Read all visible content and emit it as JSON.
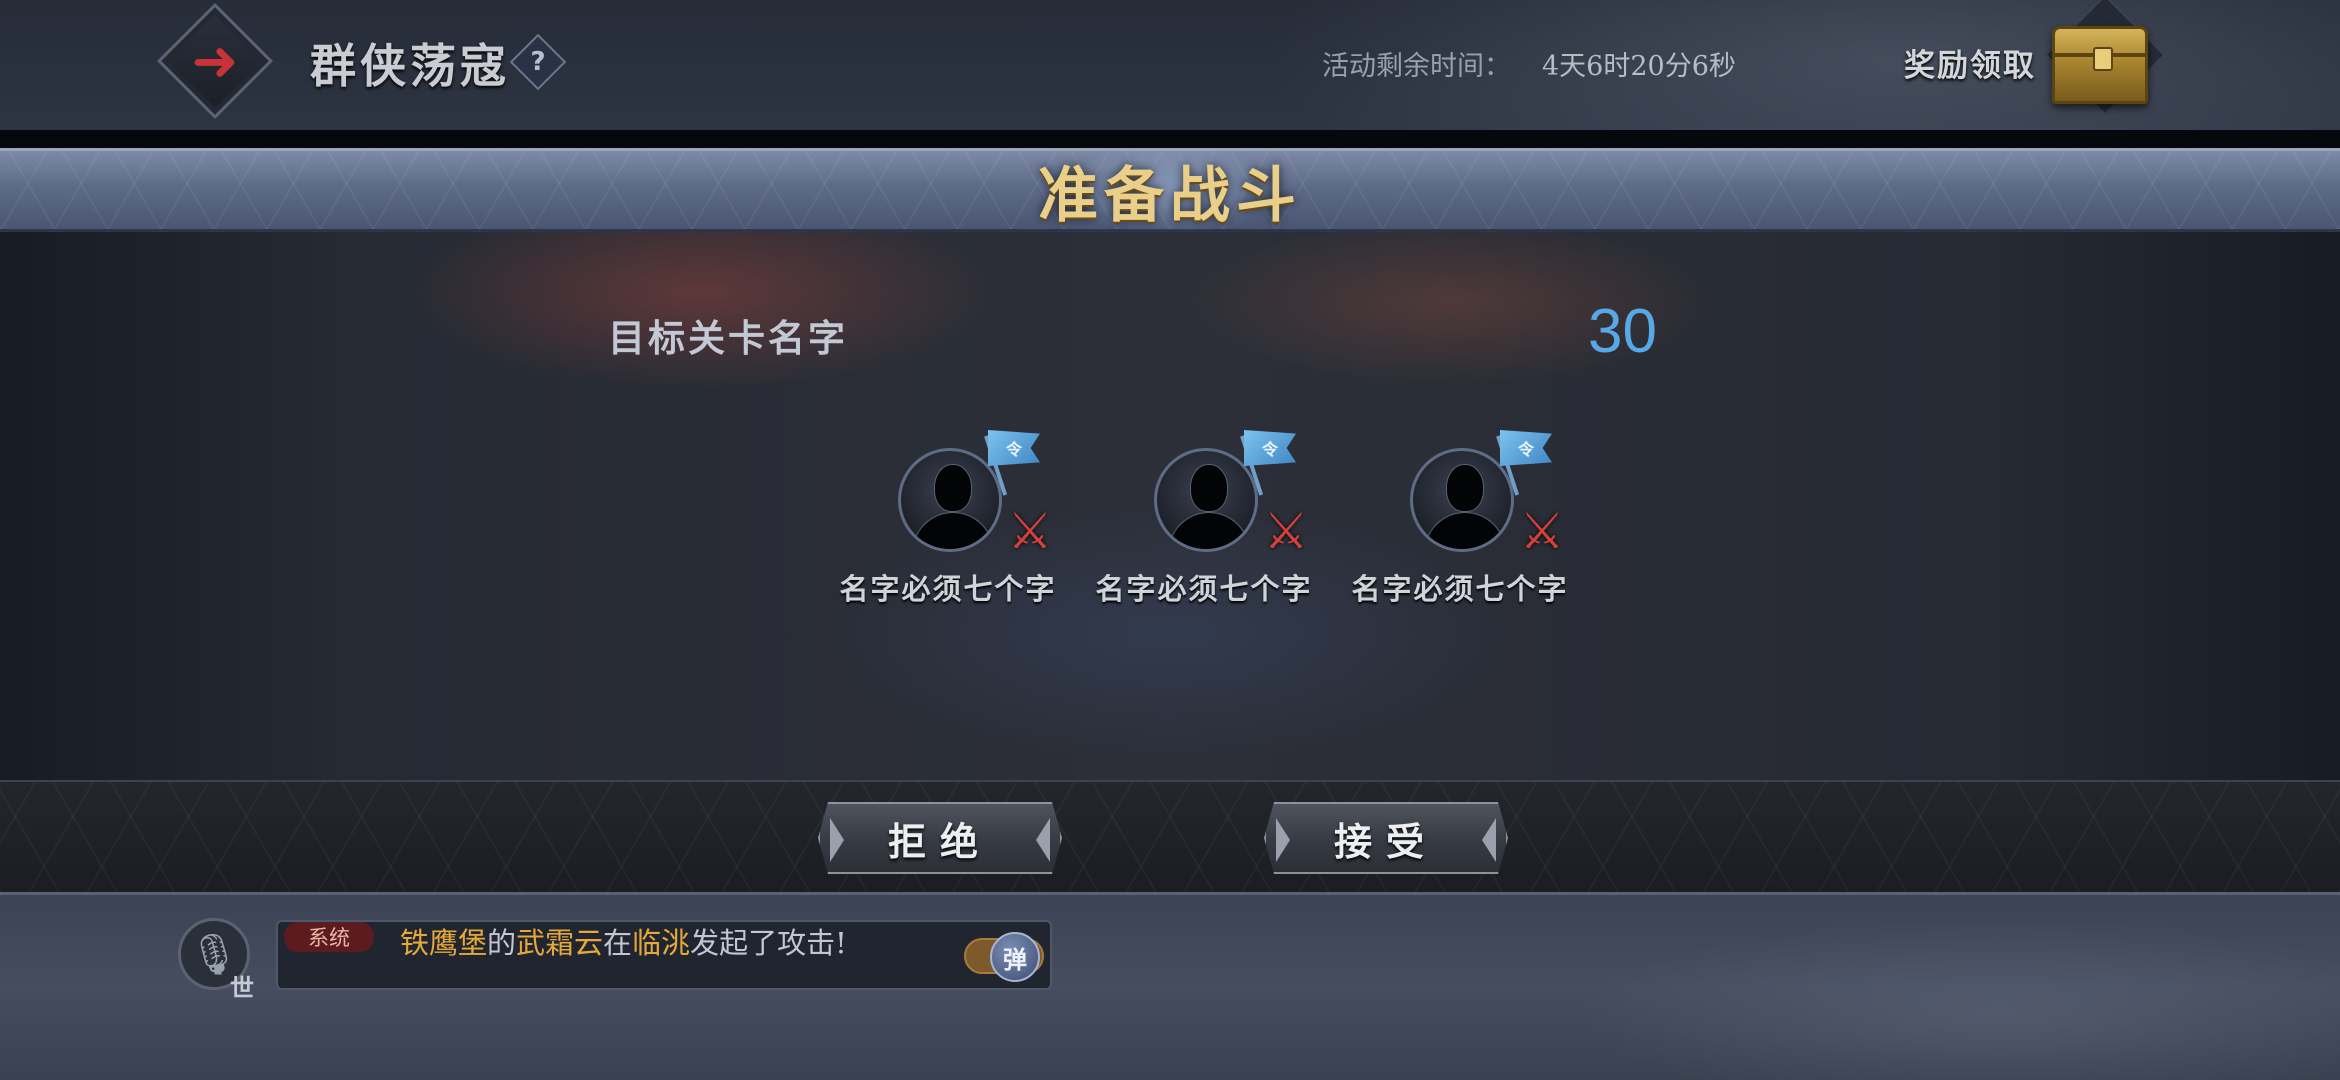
{
  "header": {
    "title": "群侠荡寇",
    "help_label": "?",
    "timer_label": "活动剩余时间：",
    "timer_value": "4天6时20分6秒",
    "reward_label": "奖励领取"
  },
  "dialog": {
    "title": "准备战斗",
    "target_name": "目标关卡名字",
    "target_level": "30",
    "members": [
      {
        "name": "名字必须七个字",
        "flag_text": "令"
      },
      {
        "name": "名字必须七个字",
        "flag_text": "令"
      },
      {
        "name": "名字必须七个字",
        "flag_text": "令"
      }
    ],
    "reject_label": "拒绝",
    "accept_label": "接受"
  },
  "chat": {
    "channel": "世",
    "tag": "系统",
    "msg": {
      "part1": "铁鹰堡",
      "part2": "的",
      "part3": "武霜云",
      "part4": "在",
      "part5": "临洮",
      "part6": "发起了攻击!"
    },
    "toggle_label": "弹"
  },
  "icons": {
    "back": "arrow-left-icon",
    "chest": "treasure-chest-icon",
    "mic": "microphone-icon",
    "flag": "flag-icon",
    "swords": "crossed-swords-icon"
  },
  "colors": {
    "accent_gold": "#e9cf8a",
    "level_blue": "#56a9e6",
    "highlight_orange": "#e4a93a",
    "danger_red": "#d0413a"
  }
}
